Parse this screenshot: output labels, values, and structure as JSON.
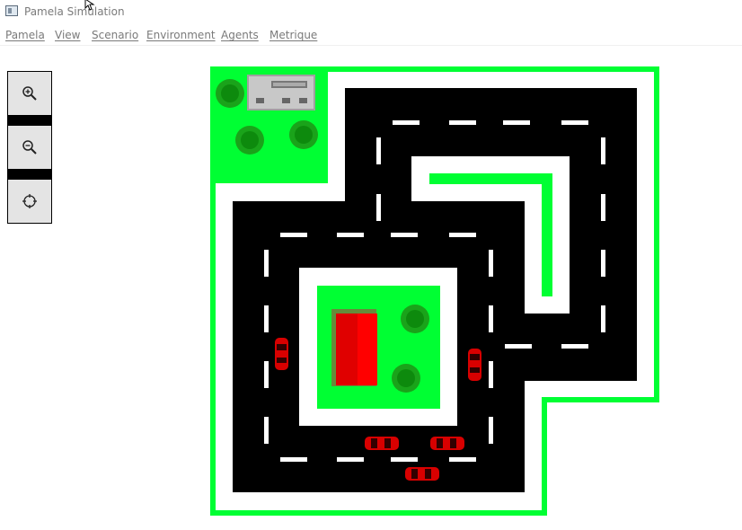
{
  "window": {
    "title": "Pamela Simulation"
  },
  "menu": {
    "items": [
      {
        "label": "Pamela"
      },
      {
        "label": "View"
      },
      {
        "label": "Scenario"
      },
      {
        "label": "Environment"
      },
      {
        "label": "Agents"
      },
      {
        "label": "Metrique"
      }
    ]
  },
  "toolbar": {
    "buttons": [
      {
        "icon": "zoom-in-icon"
      },
      {
        "icon": "zoom-out-icon"
      },
      {
        "icon": "crosshair-icon"
      }
    ]
  },
  "colors": {
    "grass": "#00ff33",
    "road": "#000000",
    "sidewalk": "#ffffff",
    "lane_marking": "#ffffff",
    "car": "#d80000",
    "building_roof": "#ff0000",
    "tree": "#1aa31a",
    "parking_lot": "#c8c8c8"
  }
}
